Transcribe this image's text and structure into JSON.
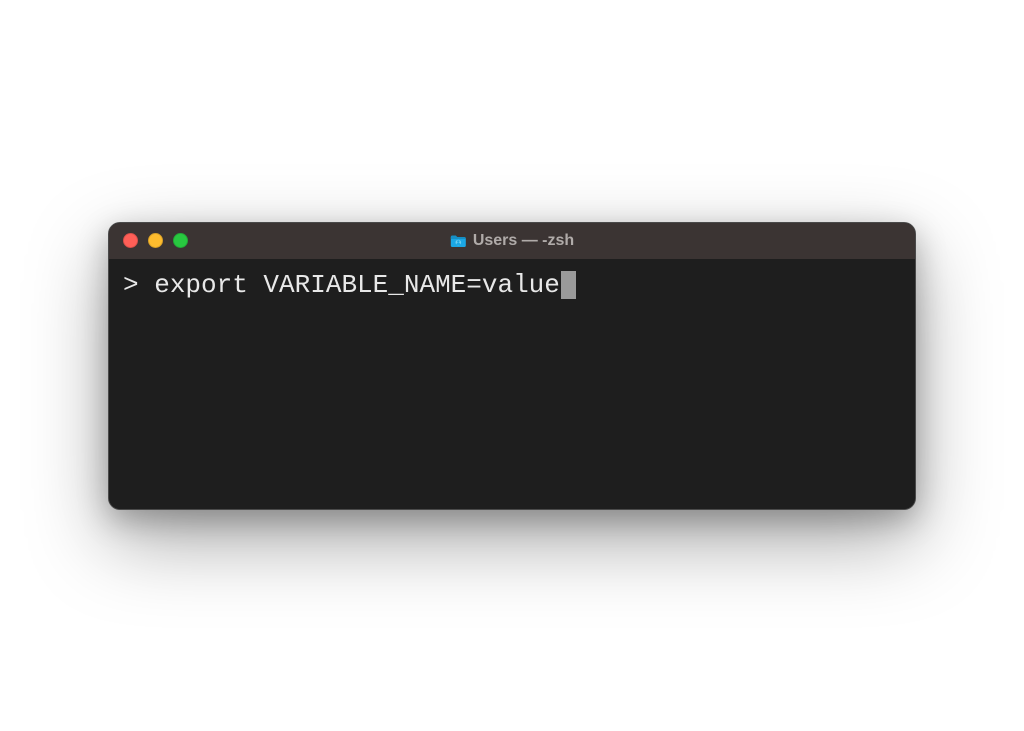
{
  "window": {
    "title": "Users — -zsh",
    "icon": "folder-icon"
  },
  "terminal": {
    "prompt": "> ",
    "command": "export VARIABLE_NAME=value"
  }
}
